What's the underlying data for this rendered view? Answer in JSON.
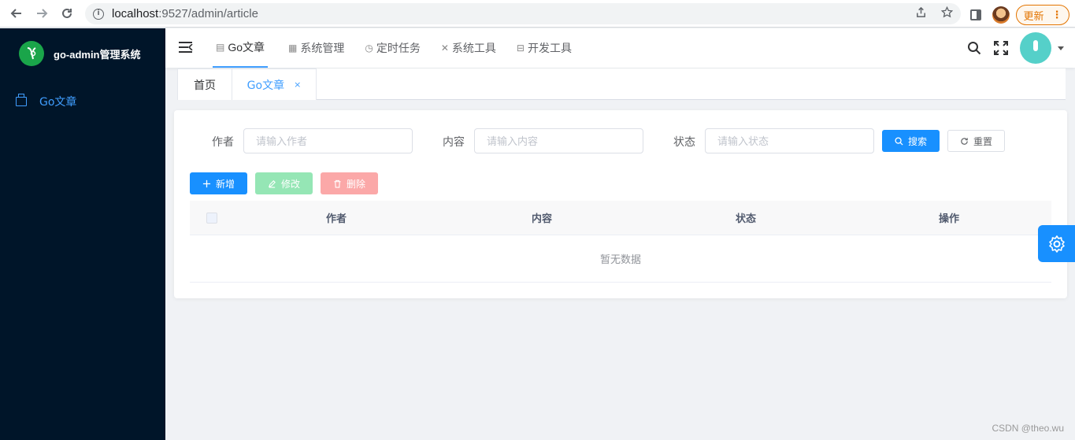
{
  "browser": {
    "url_host": "localhost",
    "url_path": ":9527/admin/article",
    "update_label": "更新"
  },
  "sidebar": {
    "app_title": "go-admin管理系统",
    "items": [
      {
        "label": "Go文章",
        "icon": "article-icon",
        "active": true
      }
    ]
  },
  "navbar": {
    "tabs": [
      {
        "label": "Go文章",
        "icon": "article-icon",
        "active": true
      },
      {
        "label": "系统管理",
        "icon": "grid-icon"
      },
      {
        "label": "定时任务",
        "icon": "clock-icon"
      },
      {
        "label": "系统工具",
        "icon": "tools-icon"
      },
      {
        "label": "开发工具",
        "icon": "dev-icon"
      }
    ]
  },
  "tags": {
    "home": "首页",
    "current": "Go文章",
    "close": "×"
  },
  "search_form": {
    "author_label": "作者",
    "author_placeholder": "请输入作者",
    "content_label": "内容",
    "content_placeholder": "请输入内容",
    "status_label": "状态",
    "status_placeholder": "请输入状态",
    "search_button": "搜索",
    "reset_button": "重置"
  },
  "toolbar": {
    "add_label": "新增",
    "edit_label": "修改",
    "delete_label": "删除"
  },
  "table": {
    "columns": [
      "作者",
      "内容",
      "状态",
      "操作"
    ],
    "empty_text": "暂无数据"
  },
  "colors": {
    "primary": "#1890ff",
    "sidebar_bg": "#001529",
    "success_light": "#95e6b5",
    "danger_light": "#fba8a8"
  },
  "watermark": "CSDN @theo.wu"
}
